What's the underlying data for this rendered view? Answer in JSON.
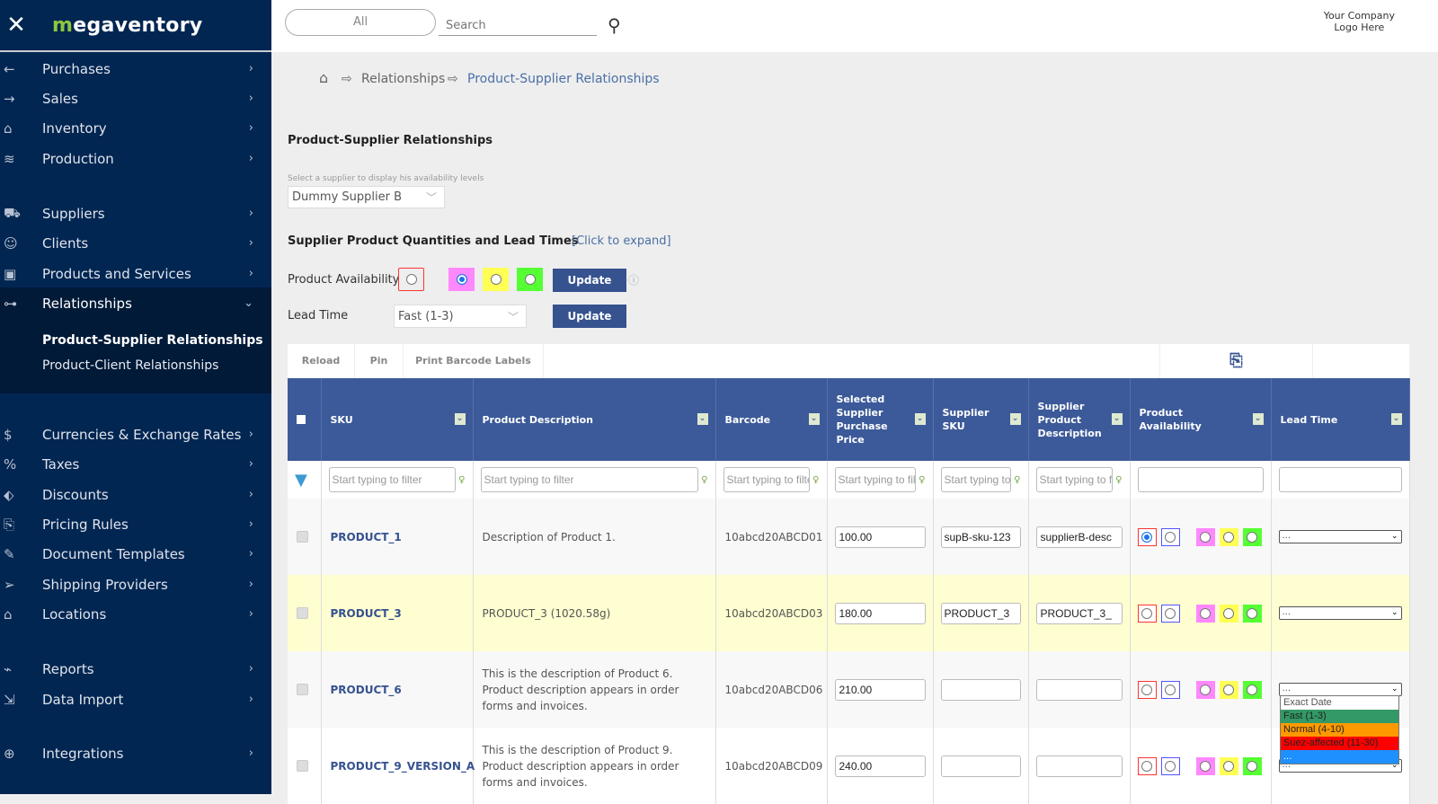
{
  "app": {
    "logo": "megaventory",
    "close_icon": "close-icon"
  },
  "sidebar": {
    "items": [
      {
        "label": "Purchases",
        "icon": "arrow-left-icon"
      },
      {
        "label": "Sales",
        "icon": "arrow-right-icon"
      },
      {
        "label": "Inventory",
        "icon": "warehouse-icon"
      },
      {
        "label": "Production",
        "icon": "layers-icon"
      },
      {
        "label": "Suppliers",
        "icon": "truck-icon"
      },
      {
        "label": "Clients",
        "icon": "users-icon"
      },
      {
        "label": "Products and Services",
        "icon": "box-icon"
      },
      {
        "label": "Relationships",
        "icon": "network-icon"
      },
      {
        "label": "Currencies & Exchange Rates",
        "icon": "dollar-icon"
      },
      {
        "label": "Taxes",
        "icon": "percent-icon"
      },
      {
        "label": "Discounts",
        "icon": "tag-icon"
      },
      {
        "label": "Pricing Rules",
        "icon": "scroll-icon"
      },
      {
        "label": "Document Templates",
        "icon": "brush-icon"
      },
      {
        "label": "Shipping Providers",
        "icon": "send-icon"
      },
      {
        "label": "Locations",
        "icon": "building-icon"
      },
      {
        "label": "Reports",
        "icon": "chart-icon"
      },
      {
        "label": "Data Import",
        "icon": "import-icon"
      },
      {
        "label": "Integrations",
        "icon": "globe-icon"
      }
    ],
    "sub_items": [
      "Product-Supplier Relationships",
      "Product-Client Relationships"
    ]
  },
  "topbar": {
    "scope": "All",
    "search_placeholder": "Search",
    "company_logo_line1": "Your Company",
    "company_logo_line2": "Logo Here"
  },
  "breadcrumb": [
    "Relationships",
    "Product-Supplier Relationships"
  ],
  "page": {
    "title": "Product-Supplier Relationships",
    "supplier_hint": "Select a supplier to display his availability levels",
    "supplier": "Dummy Supplier B",
    "section_title": "Supplier Product Quantities and Lead Times",
    "expand_link": "[Click to expand]",
    "availability_label": "Product Availability",
    "lead_time_label": "Lead Time",
    "lead_time_value": "Fast (1-3)",
    "update": "Update"
  },
  "colors": {
    "header": "#3c5a99",
    "pink": "#ff88ff",
    "yellow": "#ffff55",
    "green": "#55ff33",
    "red_border": "#ff3333",
    "blue_border": "#5555ff"
  },
  "toolbar": {
    "reload": "Reload",
    "pin": "Pin",
    "print": "Print Barcode Labels",
    "export_icon": "export-icon"
  },
  "table": {
    "columns": [
      "SKU",
      "Product Description",
      "Barcode",
      "Selected Supplier Purchase Price",
      "Supplier SKU",
      "Supplier Product Description",
      "Product Availability",
      "Lead Time"
    ],
    "filter_placeholder": "Start typing to filter",
    "rows": [
      {
        "sku": "PRODUCT_1",
        "desc": "Description of Product 1.",
        "barcode": "10abcd20ABCD01",
        "price": "100.00",
        "sup_sku": "supB-sku-123",
        "sup_desc": "supplierB-desc",
        "avail": 0,
        "lead": "..."
      },
      {
        "sku": "PRODUCT_3",
        "desc": "PRODUCT_3 (1020.58g)",
        "barcode": "10abcd20ABCD03",
        "price": "180.00",
        "sup_sku": "PRODUCT_3",
        "sup_desc": "PRODUCT_3_",
        "avail": -1,
        "lead": "..."
      },
      {
        "sku": "PRODUCT_6",
        "desc": "This is the description of Product 6. Product description appears in order forms and invoices.",
        "barcode": "10abcd20ABCD06",
        "price": "210.00",
        "sup_sku": "",
        "sup_desc": "",
        "avail": -1,
        "lead": "..."
      },
      {
        "sku": "PRODUCT_9_VERSION_A",
        "desc": "This is the description of Product 9. Product description appears in order forms and invoices.",
        "barcode": "10abcd20ABCD09",
        "price": "240.00",
        "sup_sku": "",
        "sup_desc": "",
        "avail": -1,
        "lead": "..."
      }
    ]
  },
  "lead_dropdown": [
    {
      "label": "Exact Date",
      "color": "#ffffff"
    },
    {
      "label": "Fast (1-3)",
      "color": "#339966"
    },
    {
      "label": "Normal (4-10)",
      "color": "#ff9900"
    },
    {
      "label": "Suez-affected (11-30)",
      "color": "#ff0000"
    },
    {
      "label": "...",
      "color": "#1e90ff"
    }
  ]
}
